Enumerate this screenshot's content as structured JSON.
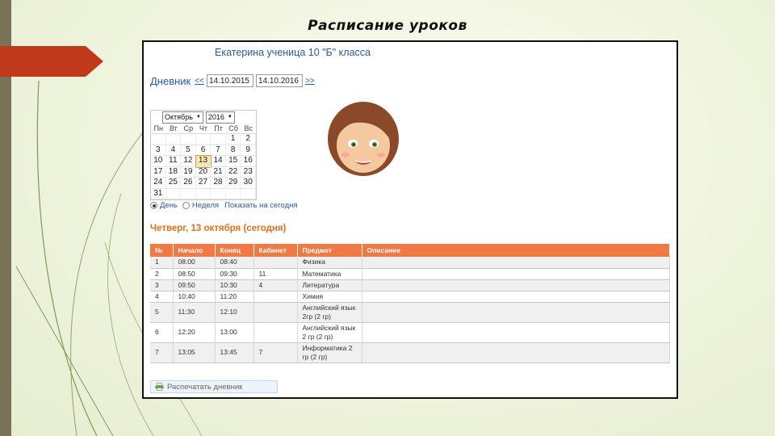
{
  "slide": {
    "title": "Расписание уроков"
  },
  "diary": {
    "student_name": "Екатерина ученица 10 \"Б\" класса",
    "label": "Дневник",
    "prev_link": "<<",
    "next_link": ">>",
    "date_from": "14.10.2015",
    "date_to": "14.10.2016"
  },
  "calendar": {
    "month": "Октябрь",
    "year": "2016",
    "weekdays": [
      "Пн",
      "Вт",
      "Ср",
      "Чт",
      "Пт",
      "Сб",
      "Вс"
    ],
    "weeks": [
      [
        "",
        "",
        "",
        "",
        "",
        "1",
        "2"
      ],
      [
        "3",
        "4",
        "5",
        "6",
        "7",
        "8",
        "9"
      ],
      [
        "10",
        "11",
        "12",
        "13",
        "14",
        "15",
        "16"
      ],
      [
        "17",
        "18",
        "19",
        "20",
        "21",
        "22",
        "23"
      ],
      [
        "24",
        "25",
        "26",
        "27",
        "28",
        "29",
        "30"
      ],
      [
        "31",
        "",
        "",
        "",
        "",
        "",
        ""
      ]
    ],
    "today": "13"
  },
  "view": {
    "day_label": "День",
    "week_label": "Неделя",
    "today_link": "Показать на сегодня",
    "selected": "day"
  },
  "day_heading": "Четверг, 13 октября (сегодня)",
  "lessons": {
    "headers": [
      "№",
      "Начало",
      "Конец",
      "Кабинет",
      "Предмет",
      "Описание"
    ],
    "rows": [
      [
        "1",
        "08:00",
        "08:40",
        "",
        "Физика",
        ""
      ],
      [
        "2",
        "08:50",
        "09:30",
        "11",
        "Математика",
        ""
      ],
      [
        "3",
        "09:50",
        "10:30",
        "4",
        "Литература",
        ""
      ],
      [
        "4",
        "10:40",
        "11:20",
        "",
        "Химия",
        ""
      ],
      [
        "5",
        "11:30",
        "12:10",
        "",
        "Английский язык 2гр (2 гр)",
        ""
      ],
      [
        "6",
        "12:20",
        "13:00",
        "",
        "Английский язык 2 гр (2 гр)",
        ""
      ],
      [
        "7",
        "13:05",
        "13:45",
        "7",
        "Информатика 2 гр (2 гр)",
        ""
      ]
    ]
  },
  "print_button": "Распечатать дневник",
  "colors": {
    "accent": "#ef7a45",
    "link": "#2a5aa0",
    "heading": "#e0701e",
    "left_bar": "#7a7257",
    "arrow": "#c0391b"
  }
}
